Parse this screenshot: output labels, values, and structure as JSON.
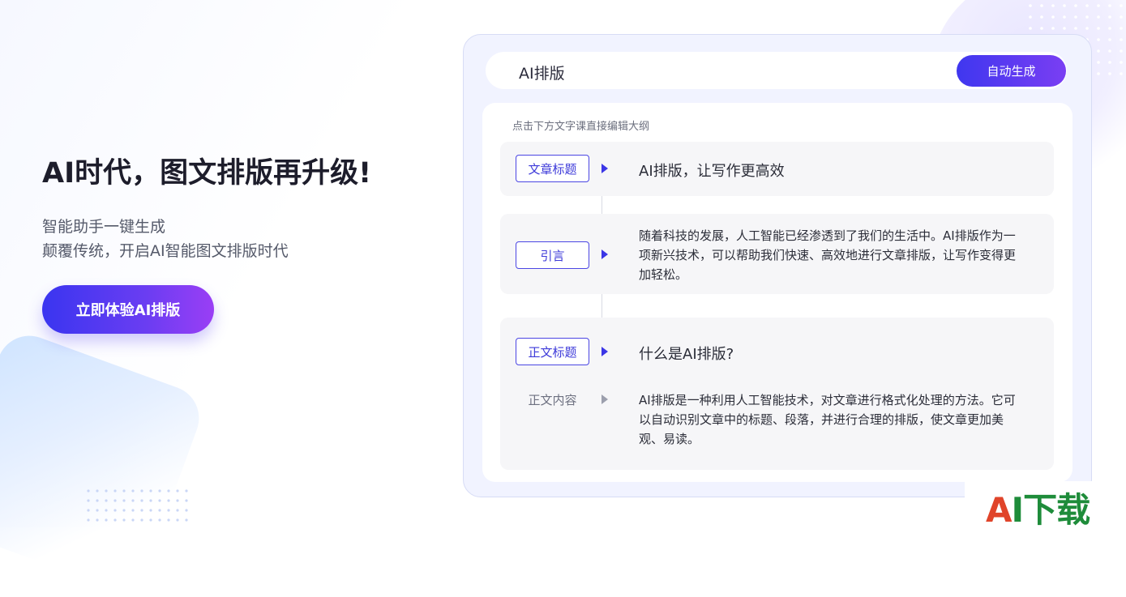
{
  "hero": {
    "title": "AI时代，图文排版再升级!",
    "subtitle_line1": "智能助手一键生成",
    "subtitle_line2": "颠覆传统，开启AI智能图文排版时代",
    "cta_label": "立即体验AI排版"
  },
  "editor": {
    "topbar_title": "AI排版",
    "auto_generate_label": "自动生成",
    "hint": "点击下方文字课直接编辑大纲",
    "rows": [
      {
        "tag": "文章标题",
        "text": "AI排版，让写作更高效"
      },
      {
        "tag": "引言",
        "text_lines": [
          "随着科技的发展，人工智能已经渗透到了我们的生活中。AI排版作为一",
          "项新兴技术，可以帮助我们快速、高效地进行文章排版，让写作变得更",
          "加轻松。"
        ]
      },
      {
        "tag": "正文标题",
        "text": "什么是AI排版?"
      },
      {
        "tag": "正文内容",
        "text_lines": [
          "AI排版是一种利用人工智能技术，对文章进行格式化处理的方法。它可",
          "以自动识别文章中的标题、段落，并进行合理的排版，使文章更加美",
          "观、易读。"
        ]
      }
    ]
  },
  "brand": {
    "a": "A",
    "rest": "I下载"
  },
  "colors": {
    "accent": "#3f37ef",
    "accent_end": "#9a3ef5",
    "brand_red": "#e0442a",
    "brand_green": "#1e8c3a"
  }
}
